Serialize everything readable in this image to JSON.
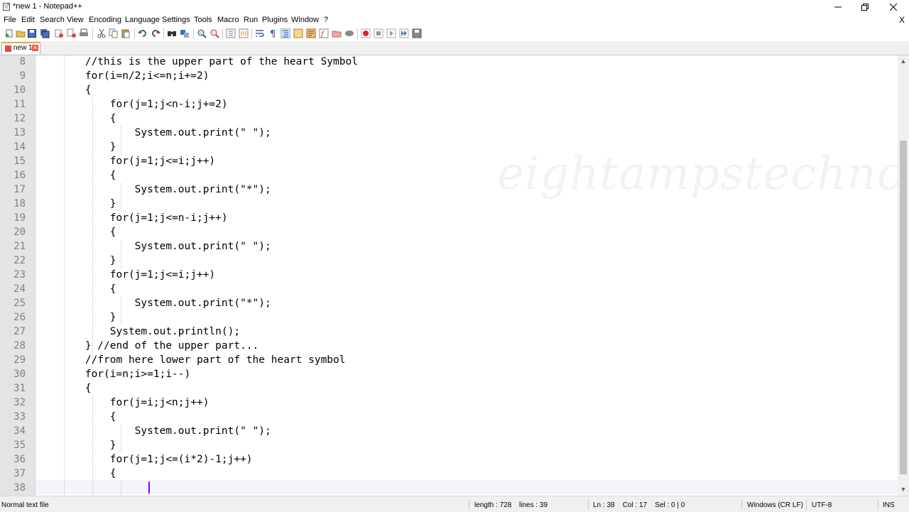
{
  "window": {
    "title": "*new 1 - Notepad++",
    "menu_close": "X"
  },
  "menu": [
    "File",
    "Edit",
    "Search",
    "View",
    "Encoding",
    "Language",
    "Settings",
    "Tools",
    "Macro",
    "Run",
    "Plugins",
    "Window",
    "?"
  ],
  "tabs": [
    {
      "label": "new 1"
    }
  ],
  "editor": {
    "watermark": "eightampstechnologies",
    "current_line": 38,
    "lines": [
      {
        "num": "8",
        "text": "        //this is the upper part of the heart Symbol"
      },
      {
        "num": "9",
        "text": "        for(i=n/2;i<=n;i+=2)"
      },
      {
        "num": "10",
        "text": "        {"
      },
      {
        "num": "11",
        "text": "            for(j=1;j<n-i;j+=2)"
      },
      {
        "num": "12",
        "text": "            {"
      },
      {
        "num": "13",
        "text": "                System.out.print(\" \");"
      },
      {
        "num": "14",
        "text": "            }"
      },
      {
        "num": "15",
        "text": "            for(j=1;j<=i;j++)"
      },
      {
        "num": "16",
        "text": "            {"
      },
      {
        "num": "17",
        "text": "                System.out.print(\"*\");"
      },
      {
        "num": "18",
        "text": "            }"
      },
      {
        "num": "19",
        "text": "            for(j=1;j<=n-i;j++)"
      },
      {
        "num": "20",
        "text": "            {"
      },
      {
        "num": "21",
        "text": "                System.out.print(\" \");"
      },
      {
        "num": "22",
        "text": "            }"
      },
      {
        "num": "23",
        "text": "            for(j=1;j<=i;j++)"
      },
      {
        "num": "24",
        "text": "            {"
      },
      {
        "num": "25",
        "text": "                System.out.print(\"*\");"
      },
      {
        "num": "26",
        "text": "            }"
      },
      {
        "num": "27",
        "text": "            System.out.println();"
      },
      {
        "num": "28",
        "text": "        } //end of the upper part..."
      },
      {
        "num": "29",
        "text": "        //from here lower part of the heart symbol"
      },
      {
        "num": "30",
        "text": "        for(i=n;i>=1;i--)"
      },
      {
        "num": "31",
        "text": "        {"
      },
      {
        "num": "32",
        "text": "            for(j=i;j<n;j++)"
      },
      {
        "num": "33",
        "text": "            {"
      },
      {
        "num": "34",
        "text": "                System.out.print(\" \");"
      },
      {
        "num": "35",
        "text": "            }"
      },
      {
        "num": "36",
        "text": "            for(j=1;j<=(i*2)-1;j++)"
      },
      {
        "num": "37",
        "text": "            {"
      },
      {
        "num": "38",
        "text": ""
      }
    ]
  },
  "status": {
    "file_type": "Normal text file",
    "length": "length : 728",
    "lines": "lines : 39",
    "position": "Ln : 38    Col : 17    Sel : 0 | 0",
    "eol": "Windows (CR LF)",
    "encoding": "UTF-8",
    "mode": "INS"
  },
  "colors": {
    "caret": "#8000ff",
    "tab_accent": "#f0a848",
    "gutter": "#e4e4e4",
    "line_number": "#808080"
  }
}
